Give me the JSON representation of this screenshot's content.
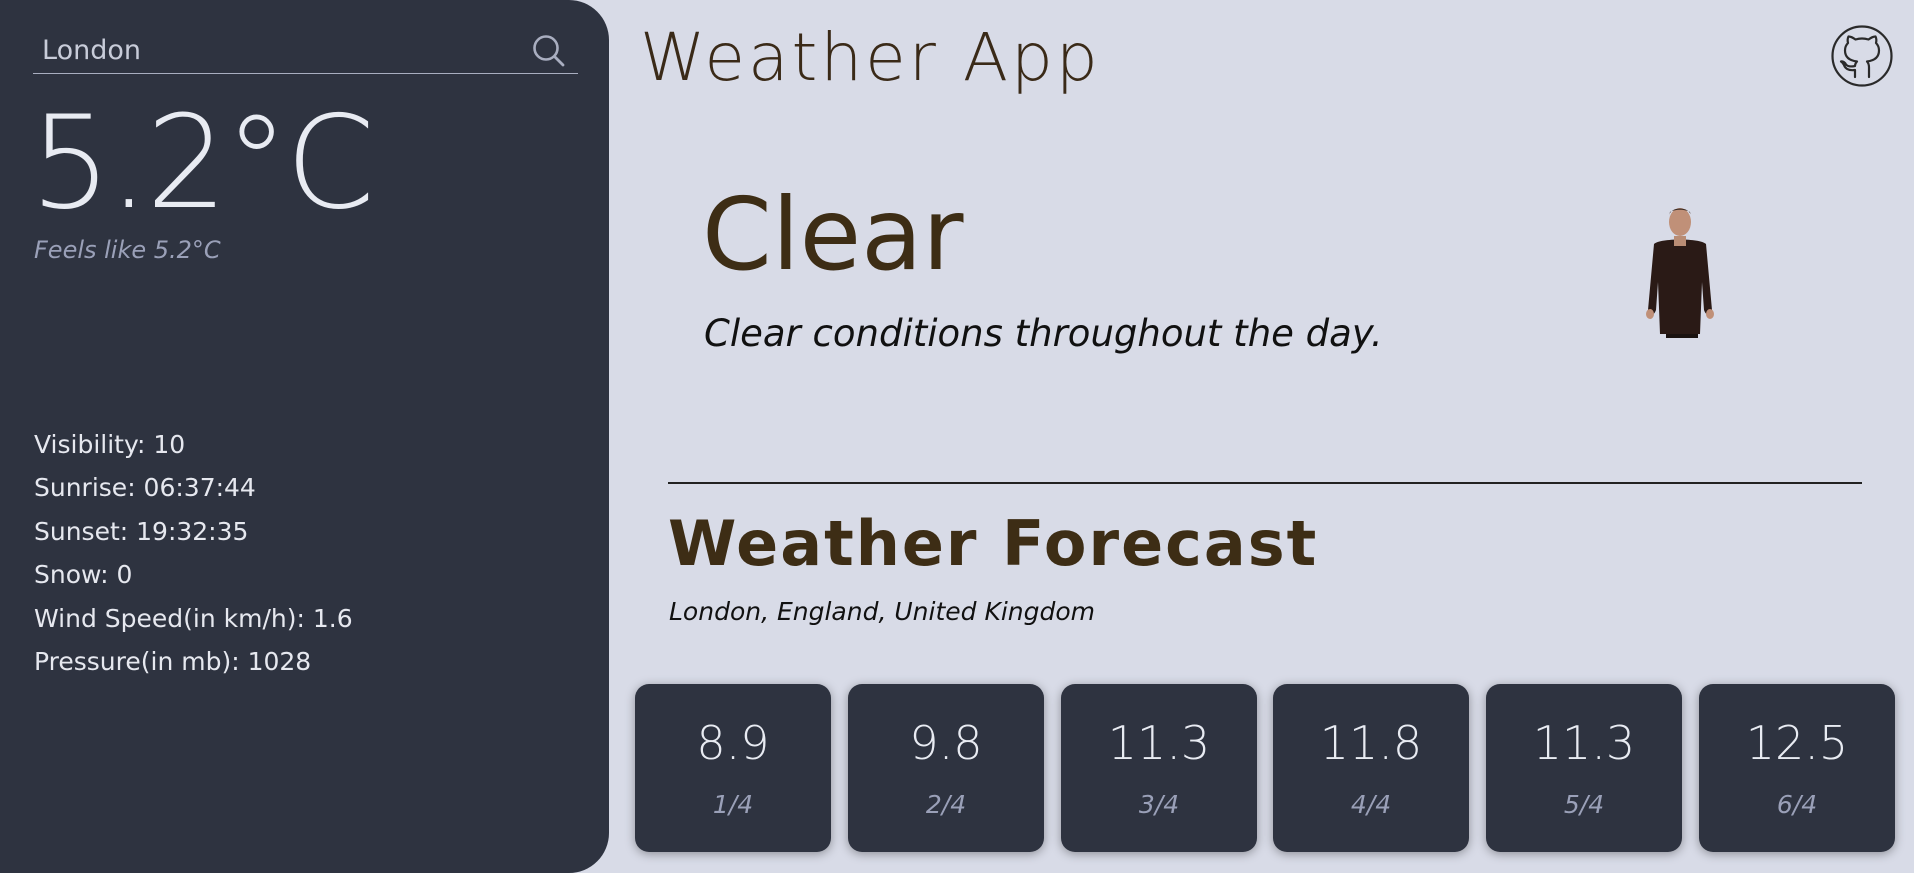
{
  "app": {
    "title": "Weather App",
    "github_icon": "github-icon"
  },
  "sidebar": {
    "search": {
      "value": "London",
      "placeholder": "London",
      "icon": "search-icon"
    },
    "temperature": "5.2°C",
    "feels_like": "Feels like 5.2°C",
    "stats": [
      "Visibility: 10",
      "Sunrise: 06:37:44",
      "Sunset: 19:32:35",
      "Snow: 0",
      "Wind Speed(in km/h): 1.6",
      "Pressure(in mb): 1028"
    ]
  },
  "current": {
    "condition": "Clear",
    "description": "Clear conditions throughout the day.",
    "gif": "presenter-gif"
  },
  "forecast": {
    "title": "Weather Forecast",
    "location": "London, England, United Kingdom",
    "days": [
      {
        "temp": "8.9",
        "date": "1/4"
      },
      {
        "temp": "9.8",
        "date": "2/4"
      },
      {
        "temp": "11.3",
        "date": "3/4"
      },
      {
        "temp": "11.8",
        "date": "4/4"
      },
      {
        "temp": "11.3",
        "date": "5/4"
      },
      {
        "temp": "12.5",
        "date": "6/4"
      }
    ]
  },
  "colors": {
    "background": "#d8dbe7",
    "panel": "#2e3340",
    "heading_brown": "#3d2d15",
    "muted_text": "#9aa0b8"
  }
}
